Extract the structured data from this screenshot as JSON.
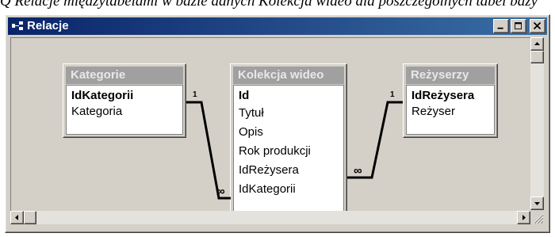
{
  "top_fragment": "Q Relacje międzytabelami w bazie danych Kolekcja wideo dla poszczególnych tabel bazy",
  "window": {
    "title": "Relacje",
    "buttons": [
      "minimize",
      "maximize",
      "close"
    ]
  },
  "tables": [
    {
      "name": "Kategorie",
      "fields": [
        {
          "label": "IdKategorii",
          "key": true
        },
        {
          "label": "Kategoria",
          "key": false
        }
      ]
    },
    {
      "name": "Kolekcja wideo",
      "fields": [
        {
          "label": "Id",
          "key": true
        },
        {
          "label": "Tytuł",
          "key": false
        },
        {
          "label": "Opis",
          "key": false
        },
        {
          "label": "Rok produkcji",
          "key": false
        },
        {
          "label": "IdReżysera",
          "key": false
        },
        {
          "label": "IdKategorii",
          "key": false
        }
      ]
    },
    {
      "name": "Reżyserzy",
      "fields": [
        {
          "label": "IdReżysera",
          "key": true
        },
        {
          "label": "Reżyser",
          "key": false
        }
      ]
    }
  ],
  "relationships": [
    {
      "from_table": "Kategorie",
      "from_field": "IdKategorii",
      "one_label": "1",
      "to_table": "Kolekcja wideo",
      "to_field": "IdKategorii",
      "many_label": "∞"
    },
    {
      "from_table": "Reżyserzy",
      "from_field": "IdReżysera",
      "one_label": "1",
      "to_table": "Kolekcja wideo",
      "to_field": "IdReżysera",
      "many_label": "∞"
    }
  ],
  "icons": {
    "window_icon": "relationships-icon"
  }
}
